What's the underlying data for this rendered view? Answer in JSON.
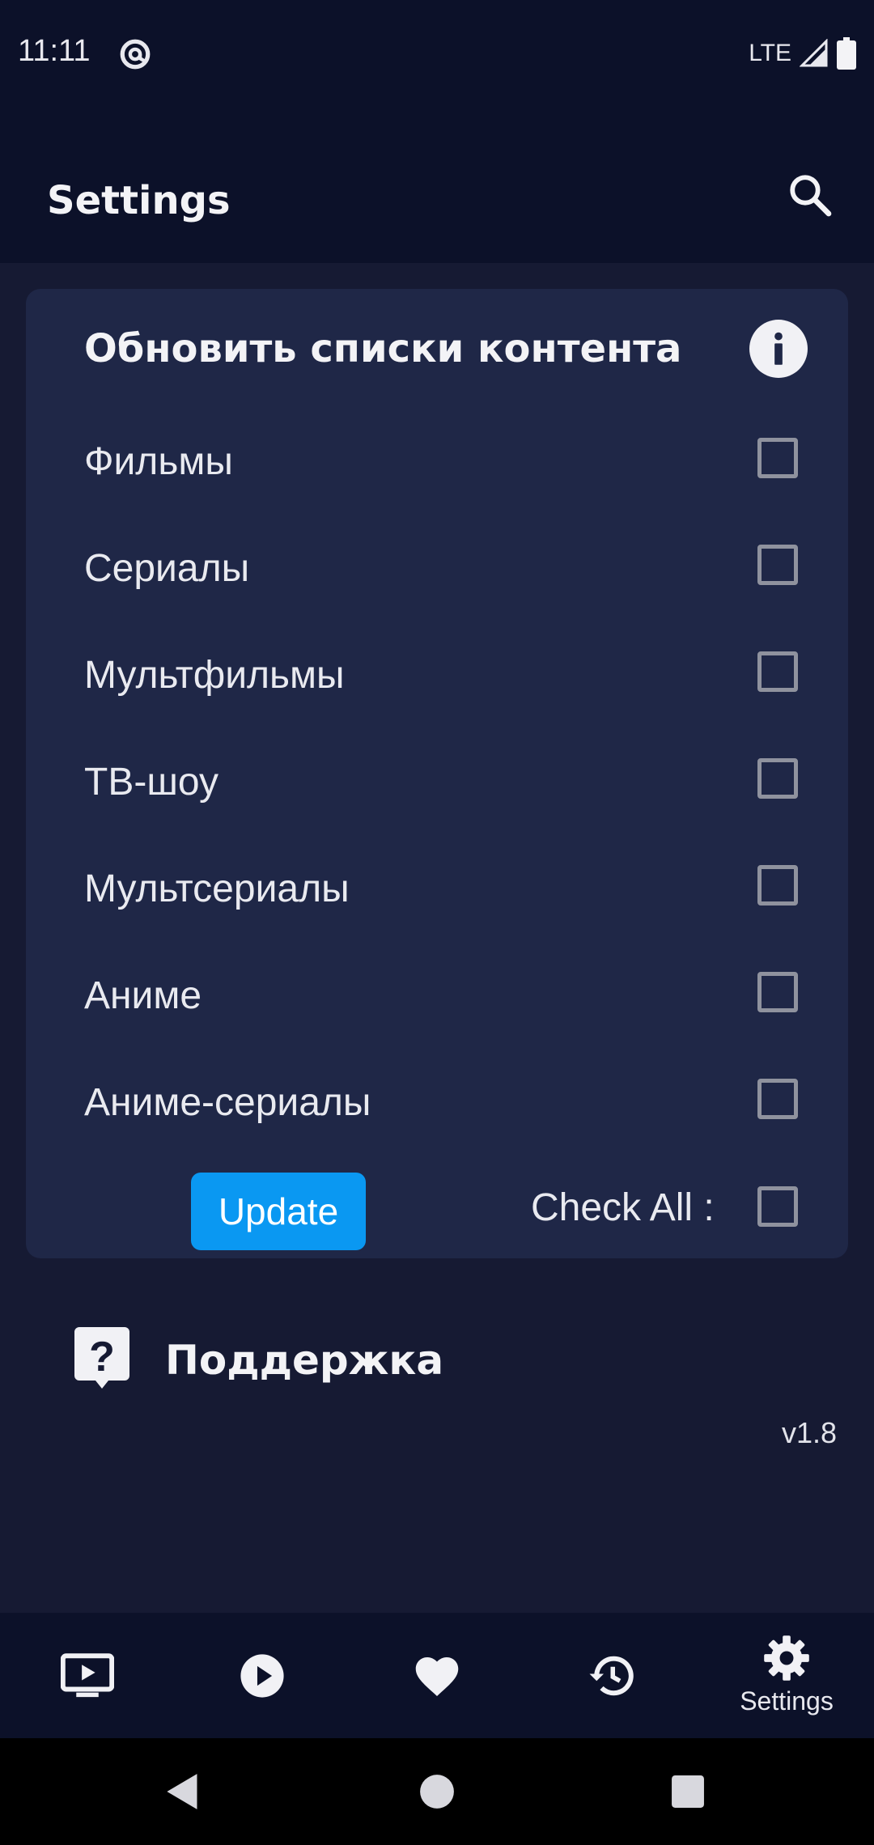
{
  "status_bar": {
    "time": "11:11",
    "network": "LTE",
    "icons": [
      "at-sign-icon",
      "signal-icon",
      "battery-icon"
    ]
  },
  "app_bar": {
    "title": "Settings",
    "search_icon": "search-icon"
  },
  "update_card": {
    "title": "Обновить списки контента",
    "info_icon": "info-icon",
    "items": [
      {
        "label": "Фильмы",
        "checked": false
      },
      {
        "label": "Сериалы",
        "checked": false
      },
      {
        "label": "Мультфильмы",
        "checked": false
      },
      {
        "label": "ТВ-шоу",
        "checked": false
      },
      {
        "label": "Мультсериалы",
        "checked": false
      },
      {
        "label": "Аниме",
        "checked": false
      },
      {
        "label": "Аниме-сериалы",
        "checked": false
      }
    ],
    "update_label": "Update",
    "check_all_label": "Check All :",
    "check_all_checked": false
  },
  "support": {
    "label": "Поддержка",
    "icon": "question-bubble-icon"
  },
  "version": "v1.8",
  "bottom_nav": {
    "items": [
      {
        "icon": "tv-icon",
        "label": ""
      },
      {
        "icon": "play-icon",
        "label": ""
      },
      {
        "icon": "heart-icon",
        "label": ""
      },
      {
        "icon": "history-icon",
        "label": ""
      },
      {
        "icon": "gear-icon",
        "label": "Settings",
        "active": true
      }
    ]
  },
  "colors": {
    "background": "#161a33",
    "bar": "#0c1129",
    "card": "#1f2747",
    "accent": "#0a98f2",
    "checkbox_border": "#8f929e"
  }
}
